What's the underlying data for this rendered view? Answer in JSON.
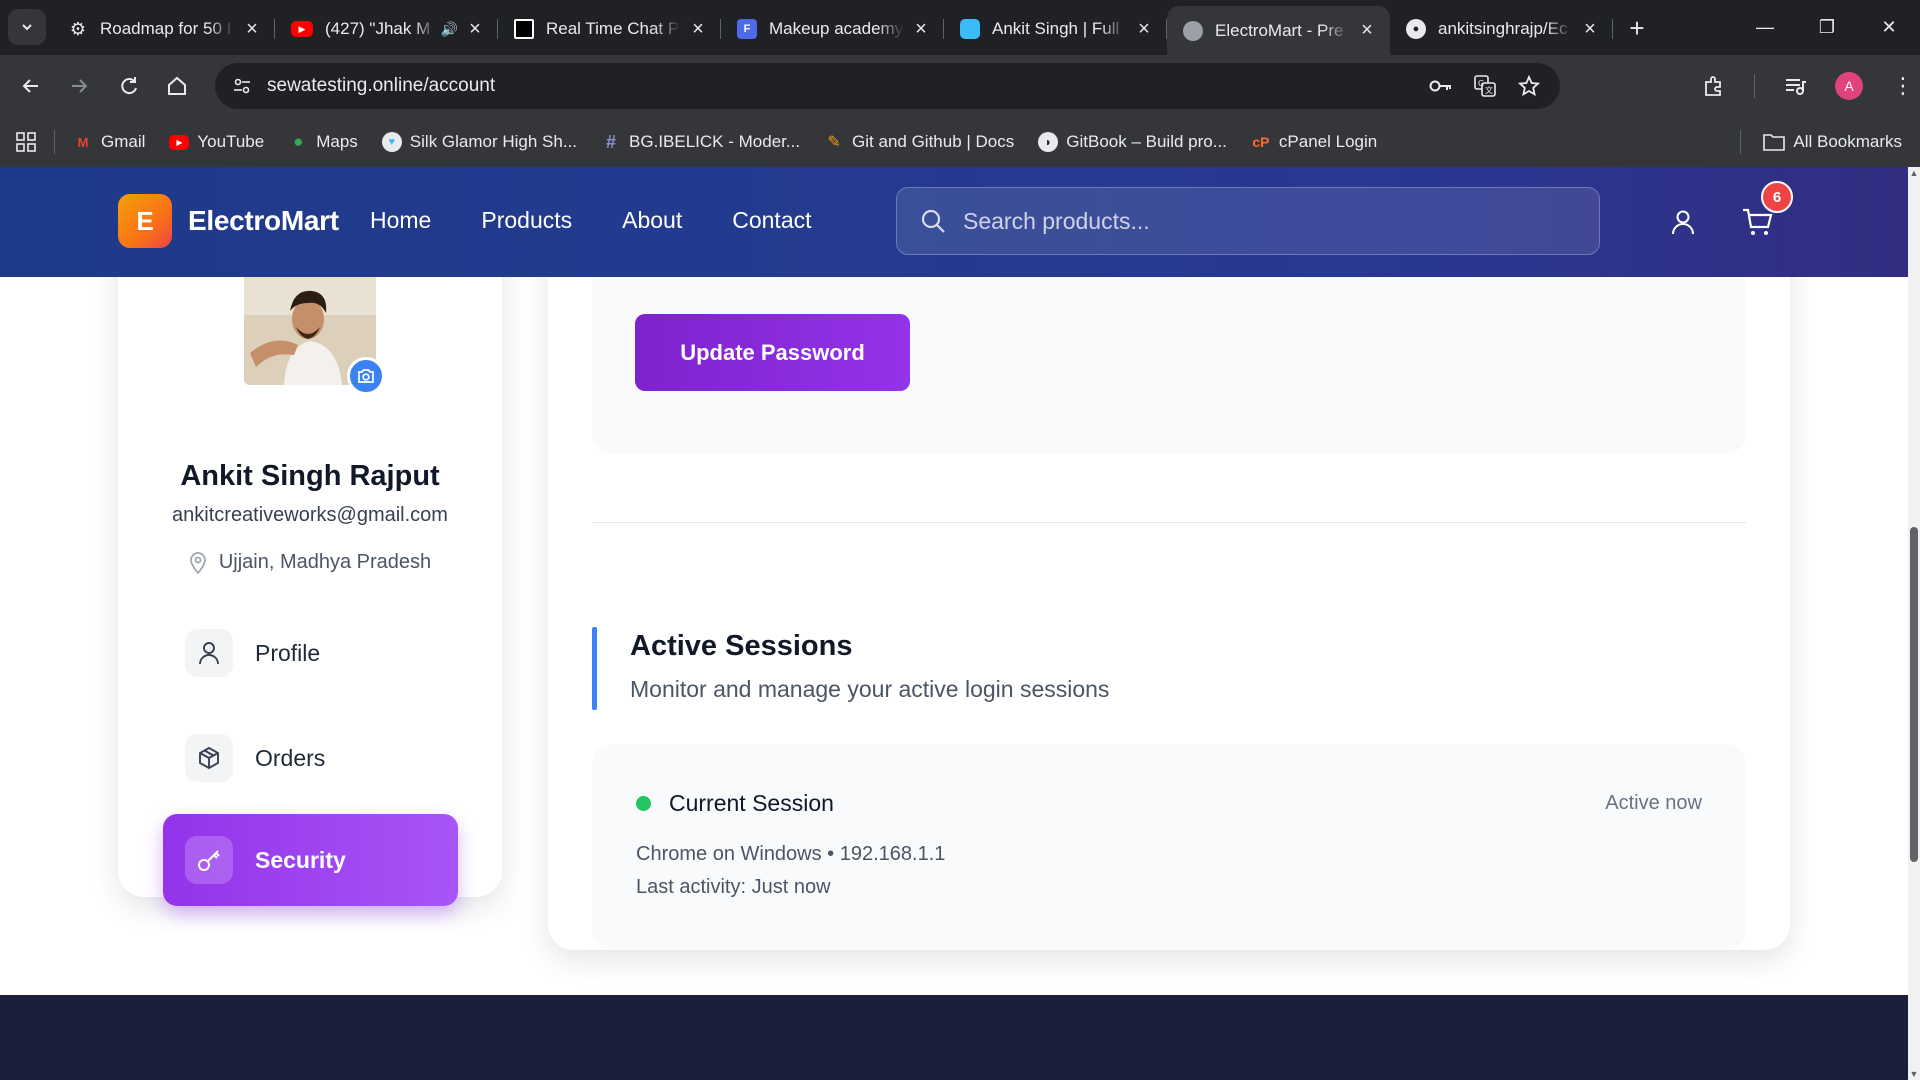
{
  "browser": {
    "tabs": [
      {
        "title": "Roadmap for 50 I",
        "favicon": "openai-icon"
      },
      {
        "title": "(427) \"Jhak M",
        "favicon": "youtube-icon"
      },
      {
        "title": "Real Time Chat Pl",
        "favicon": "app-icon"
      },
      {
        "title": "Makeup academy",
        "favicon": "forms-icon"
      },
      {
        "title": "Ankit Singh | Full",
        "favicon": "briefcase-icon"
      },
      {
        "title": "ElectroMart - Pre",
        "favicon": "globe-icon"
      },
      {
        "title": "ankitsinghrajp/Ec",
        "favicon": "github-icon"
      }
    ],
    "active_tab_index": 5,
    "url": "sewatesting.online/account",
    "profile_initial": "A",
    "bookmarks": [
      {
        "label": "Gmail",
        "icon": "gmail-icon"
      },
      {
        "label": "YouTube",
        "icon": "youtube-icon"
      },
      {
        "label": "Maps",
        "icon": "maps-icon"
      },
      {
        "label": "Silk Glamor High Sh...",
        "icon": "tooth-icon"
      },
      {
        "label": "BG.IBELICK - Moder...",
        "icon": "hash-icon"
      },
      {
        "label": "Git and Github | Docs",
        "icon": "doc-icon"
      },
      {
        "label": "GitBook – Build pro...",
        "icon": "gitbook-icon"
      },
      {
        "label": "cPanel Login",
        "icon": "cpanel-icon"
      }
    ],
    "all_bookmarks_label": "All Bookmarks"
  },
  "site": {
    "logo_letter": "E",
    "brand": "ElectroMart",
    "nav": [
      "Home",
      "Products",
      "About",
      "Contact"
    ],
    "search_placeholder": "Search products...",
    "cart_count": "6"
  },
  "profile": {
    "name": "Ankit Singh Rajput",
    "email": "ankitcreativeworks@gmail.com",
    "location": "Ujjain, Madhya Pradesh",
    "menu": [
      {
        "label": "Profile",
        "icon": "user-icon",
        "active": false
      },
      {
        "label": "Orders",
        "icon": "package-icon",
        "active": false
      },
      {
        "label": "Security",
        "icon": "key-icon",
        "active": true
      }
    ]
  },
  "security": {
    "update_button": "Update Password",
    "sessions_title": "Active Sessions",
    "sessions_subtitle": "Monitor and manage your active login sessions",
    "session": {
      "title": "Current Session",
      "status": "Active now",
      "device": "Chrome on Windows • 192.168.1.1",
      "last_activity": "Last activity: Just now"
    }
  },
  "colors": {
    "header_start": "#1e3a8a",
    "header_end": "#312e81",
    "accent_purple": "#9333ea",
    "accent_blue": "#3b82f6",
    "status_green": "#22c55e",
    "badge_red": "#ef4444"
  }
}
